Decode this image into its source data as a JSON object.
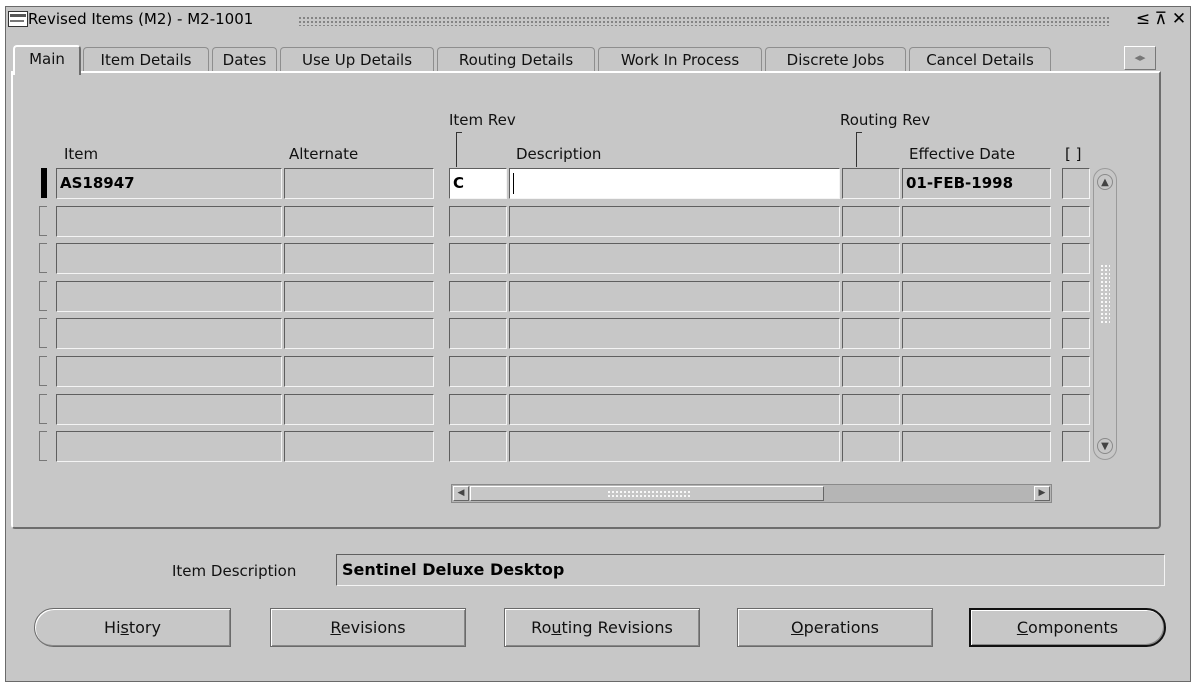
{
  "window": {
    "title": "Revised Items (M2) - M2-1001",
    "controls": [
      "≤",
      "⊼",
      "✕"
    ]
  },
  "tabs": [
    {
      "label": "Main",
      "active": true
    },
    {
      "label": "Item Details",
      "active": false
    },
    {
      "label": "Dates",
      "active": false
    },
    {
      "label": "Use Up Details",
      "active": false
    },
    {
      "label": "Routing Details",
      "active": false
    },
    {
      "label": "Work In Process",
      "active": false
    },
    {
      "label": "Discrete Jobs",
      "active": false
    },
    {
      "label": "Cancel Details",
      "active": false
    }
  ],
  "tab_scroll_icon": "◂▸",
  "grid": {
    "headers": {
      "item": "Item",
      "alternate": "Alternate",
      "item_rev": "Item Rev",
      "description": "Description",
      "routing_rev": "Routing Rev",
      "effective_date": "Effective Date",
      "flex": "[ ]"
    },
    "rows": [
      {
        "item": "AS18947",
        "alternate": "",
        "item_rev": "C",
        "description": "",
        "routing_rev": "",
        "effective_date": "01-FEB-1998"
      },
      {
        "item": "",
        "alternate": "",
        "item_rev": "",
        "description": "",
        "routing_rev": "",
        "effective_date": ""
      },
      {
        "item": "",
        "alternate": "",
        "item_rev": "",
        "description": "",
        "routing_rev": "",
        "effective_date": ""
      },
      {
        "item": "",
        "alternate": "",
        "item_rev": "",
        "description": "",
        "routing_rev": "",
        "effective_date": ""
      },
      {
        "item": "",
        "alternate": "",
        "item_rev": "",
        "description": "",
        "routing_rev": "",
        "effective_date": ""
      },
      {
        "item": "",
        "alternate": "",
        "item_rev": "",
        "description": "",
        "routing_rev": "",
        "effective_date": ""
      },
      {
        "item": "",
        "alternate": "",
        "item_rev": "",
        "description": "",
        "routing_rev": "",
        "effective_date": ""
      },
      {
        "item": "",
        "alternate": "",
        "item_rev": "",
        "description": "",
        "routing_rev": "",
        "effective_date": ""
      }
    ]
  },
  "item_description": {
    "label": "Item Description",
    "value": "Sentinel Deluxe Desktop"
  },
  "buttons": {
    "history": {
      "pre": "Hi",
      "u": "s",
      "post": "tory"
    },
    "revisions": {
      "pre": "",
      "u": "R",
      "post": "evisions"
    },
    "routing_revisions": {
      "pre": "Ro",
      "u": "u",
      "post": "ting Revisions"
    },
    "operations": {
      "pre": "",
      "u": "O",
      "post": "perations"
    },
    "components": {
      "pre": "",
      "u": "C",
      "post": "omponents"
    }
  }
}
